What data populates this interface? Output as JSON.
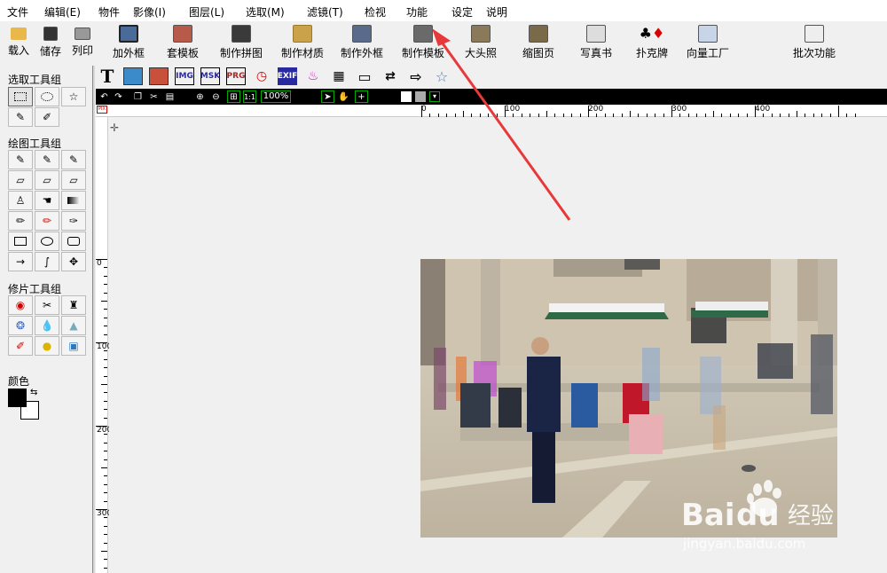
{
  "menu": [
    "文件",
    "编辑(E)",
    "物件",
    "影像(I)",
    "图层(L)",
    "选取(M)",
    "滤镜(T)",
    "检视",
    "功能",
    "设定",
    "说明"
  ],
  "toolbar": {
    "load": "载入",
    "save": "储存",
    "print": "列印",
    "frame": "加外框",
    "template": "套模板",
    "collage": "制作拼图",
    "material": "制作材质",
    "make_frame": "制作外框",
    "make_template": "制作模板",
    "photo_id": "大头照",
    "thumbnail": "缩图页",
    "photobook": "写真书",
    "cards": "扑克牌",
    "vector": "向量工厂",
    "batch": "批次功能"
  },
  "panels": {
    "select_title": "选取工具组",
    "draw_title": "绘图工具组",
    "retouch_title": "修片工具组",
    "color_title": "颜色"
  },
  "iconrow": {
    "img": "IMG",
    "msk": "MSK",
    "prg": "PRG",
    "exif": "EXIF",
    "text": "T"
  },
  "viewbar": {
    "zoom": "100%"
  },
  "ruler": {
    "top": [
      "0",
      "100",
      "200",
      "300",
      "400"
    ],
    "left": [
      "0",
      "100",
      "200",
      "300"
    ],
    "unit": "PIX"
  },
  "watermark": {
    "brand": "Bai",
    "brand2": "du",
    "cn": "经验",
    "url": "jingyan.baidu.com"
  },
  "colors": {
    "foreground": "#000000",
    "background": "#ffffff",
    "arrow": "#e8393a"
  }
}
